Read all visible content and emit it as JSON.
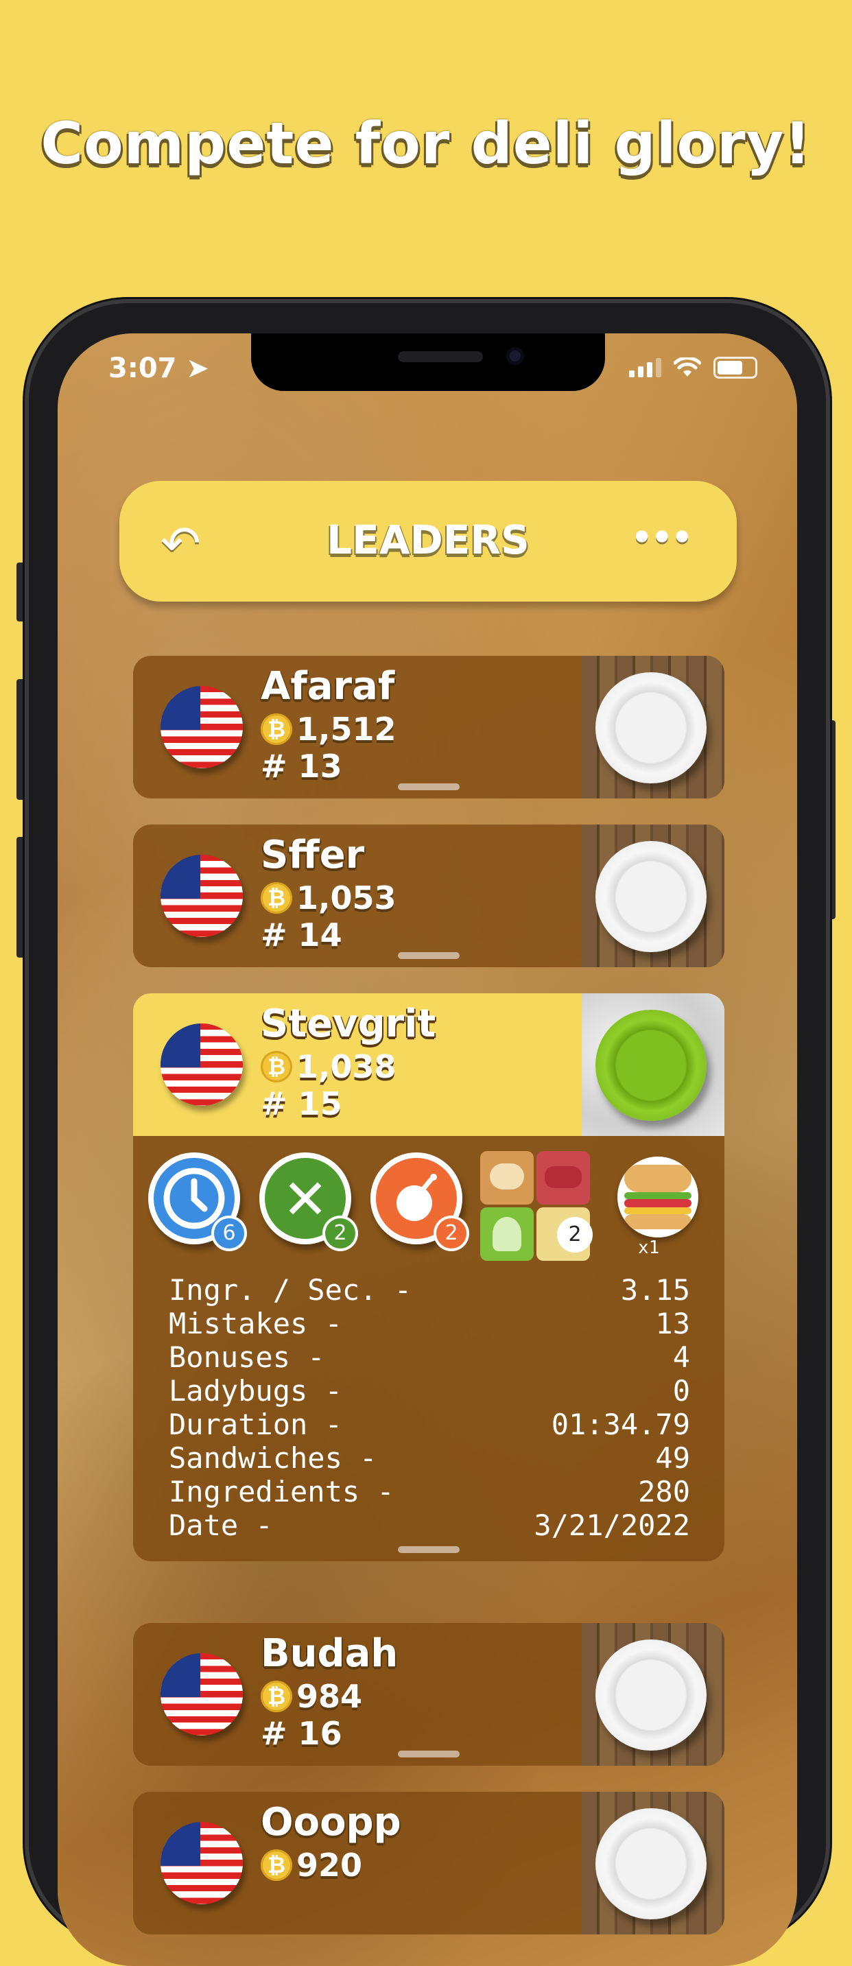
{
  "headline": "Compete for deli glory!",
  "status": {
    "time": "3:07"
  },
  "header": {
    "back_icon": "↶",
    "title": "LEADERS",
    "more_icon": "•••"
  },
  "rows": [
    {
      "name": "Afaraf",
      "coins": "1,512",
      "rank": "# 13"
    },
    {
      "name": "Sffer",
      "coins": "1,053",
      "rank": "# 14"
    },
    {
      "name": "Stevgrit",
      "coins": "1,038",
      "rank": "# 15"
    },
    {
      "name": "Budah",
      "coins": "984",
      "rank": "# 16"
    },
    {
      "name": "Ooopp",
      "coins": "920",
      "rank": ""
    }
  ],
  "coin_symbol": "₿",
  "detail": {
    "badges": {
      "clock": "6",
      "mistakes": "2",
      "bomb": "2",
      "ingredient": "2",
      "sandwich_multiplier": "x1"
    },
    "stats": [
      {
        "label": "Ingr. / Sec. -",
        "value": "3.15"
      },
      {
        "label": "Mistakes -",
        "value": "13"
      },
      {
        "label": "Bonuses -",
        "value": "4"
      },
      {
        "label": "Ladybugs -",
        "value": "0"
      },
      {
        "label": "Duration -",
        "value": "01:34.79"
      },
      {
        "label": "Sandwiches -",
        "value": "49"
      },
      {
        "label": "Ingredients -",
        "value": "280"
      },
      {
        "label": "Date -",
        "value": "3/21/2022"
      }
    ]
  },
  "colors": {
    "background": "#F5D85C",
    "row_brown": "#80 4C 12",
    "clock_blue": "#3A8DE0",
    "mistake_green": "#4E9A2F",
    "bomb_orange": "#F06A34"
  }
}
